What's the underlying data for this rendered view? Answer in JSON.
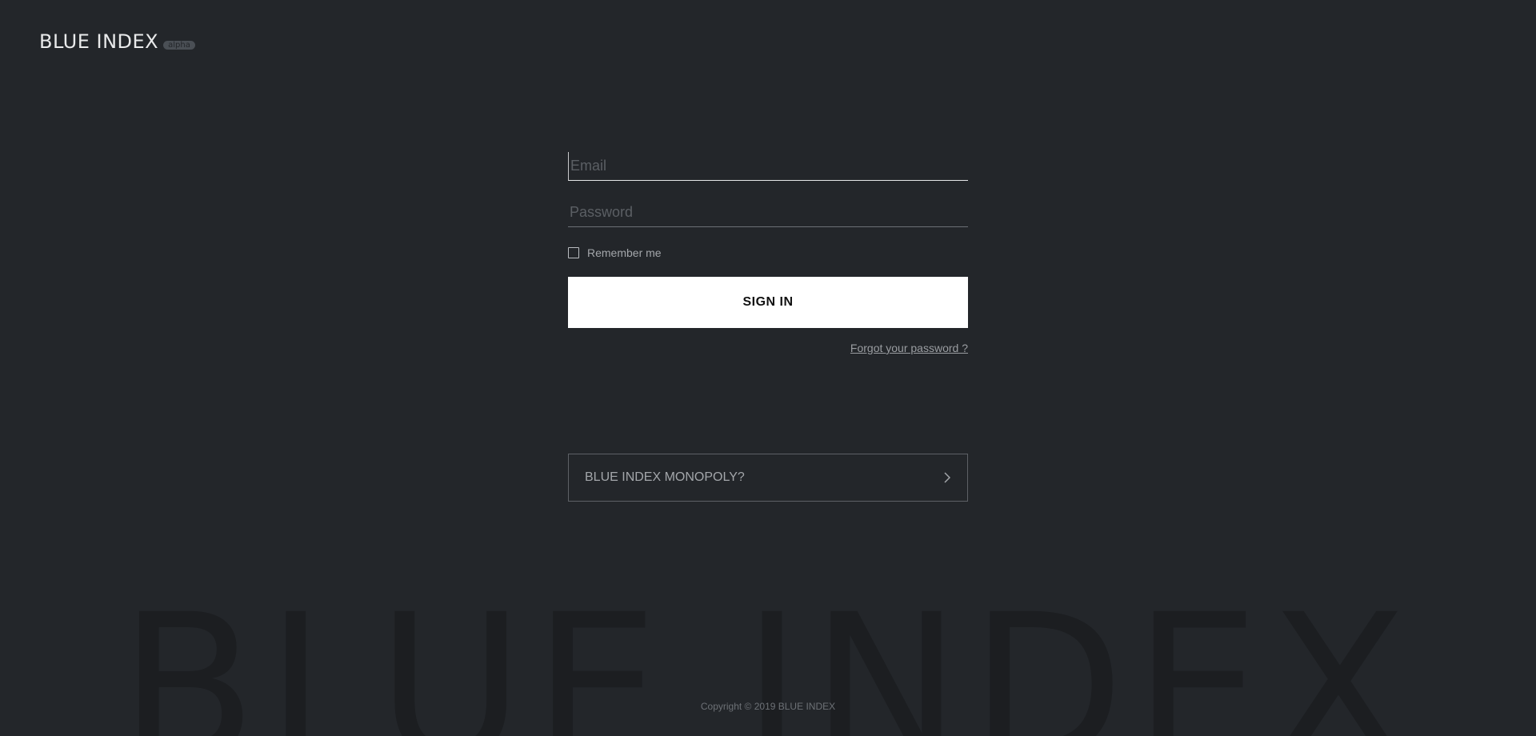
{
  "logo": {
    "text": "BLUE INDEX",
    "badge": "alpha"
  },
  "form": {
    "email_placeholder": "Email",
    "email_value": "",
    "password_placeholder": "Password",
    "password_value": "",
    "remember_label": "Remember me",
    "remember_checked": false,
    "signin_label": "SIGN IN",
    "forgot_label": "Forgot your password ?"
  },
  "monopoly": {
    "label": "BLUE INDEX MONOPOLY?",
    "icon": "chevron-right-icon"
  },
  "watermark": "BLUE INDEX",
  "footer": {
    "copyright": "Copyright © 2019 BLUE INDEX"
  },
  "colors": {
    "background": "#23262a",
    "button_bg": "#ffffff",
    "watermark": "#1c1e21"
  }
}
